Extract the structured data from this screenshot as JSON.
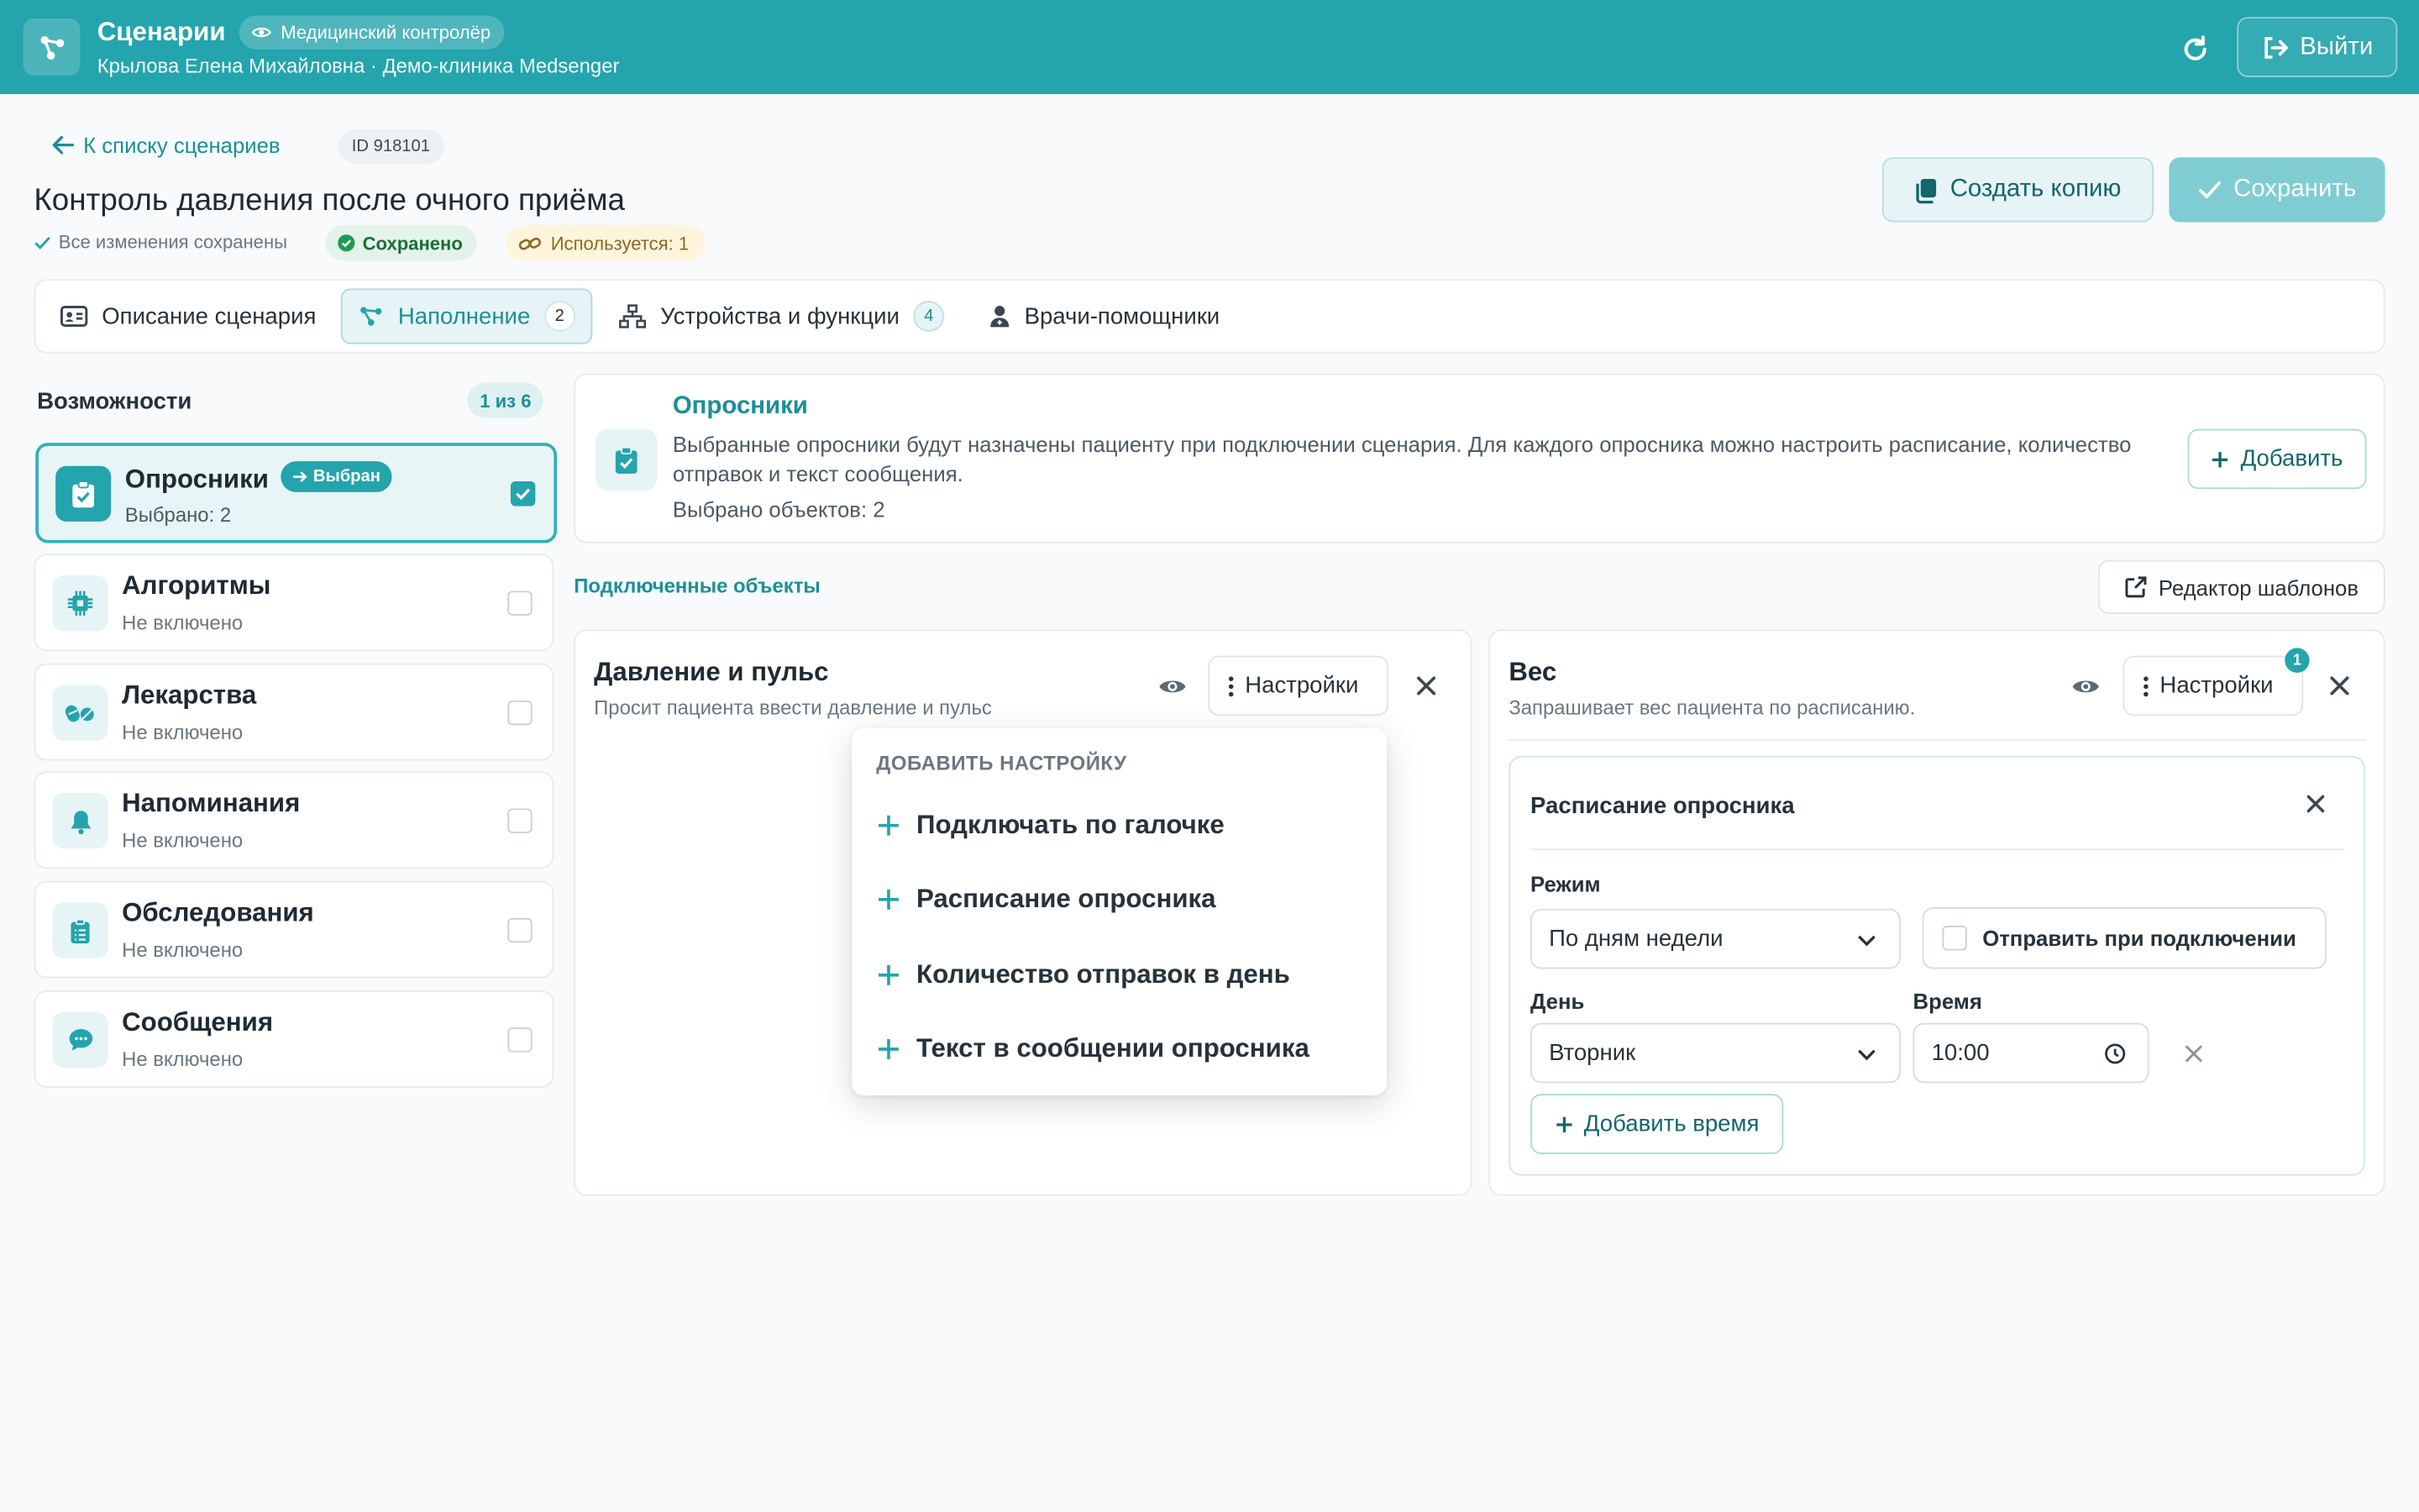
{
  "header": {
    "title": "Сценарии",
    "role": "Медицинский контролёр",
    "user": "Крылова Елена Михайловна · Демо-клиника Medsenger",
    "logout": "Выйти"
  },
  "top": {
    "back": "К списку сценариев",
    "id": "ID 918101",
    "title": "Контроль давления после очного приёма",
    "saved_note": "Все изменения сохранены",
    "badge_saved": "Сохранено",
    "badge_used": "Используется: 1",
    "btn_copy": "Создать копию",
    "btn_save": "Сохранить"
  },
  "tabs": [
    {
      "label": "Описание сценария",
      "count": ""
    },
    {
      "label": "Наполнение",
      "count": "2"
    },
    {
      "label": "Устройства и функции",
      "count": "4"
    },
    {
      "label": "Врачи-помощники",
      "count": ""
    }
  ],
  "capabilities": {
    "title": "Возможности",
    "count": "1 из 6",
    "selected_badge": "Выбран",
    "items": [
      {
        "title": "Опросники",
        "sub": "Выбрано: 2",
        "icon": "clipboard-check-icon"
      },
      {
        "title": "Алгоритмы",
        "sub": "Не включено",
        "icon": "chip-icon"
      },
      {
        "title": "Лекарства",
        "sub": "Не включено",
        "icon": "pills-icon"
      },
      {
        "title": "Напоминания",
        "sub": "Не включено",
        "icon": "bell-icon"
      },
      {
        "title": "Обследования",
        "sub": "Не включено",
        "icon": "clipboard-list-icon"
      },
      {
        "title": "Сообщения",
        "sub": "Не включено",
        "icon": "chat-icon"
      }
    ]
  },
  "info": {
    "title": "Опросники",
    "desc": "Выбранные опросники будут назначены пациенту при подключении сценария. Для каждого опросника можно настроить расписание, количество отправок и текст сообщения.",
    "count": "Выбрано объектов: 2",
    "btn_add": "Добавить"
  },
  "connected": {
    "title": "Подключенные объекты",
    "btn_templates": "Редактор шаблонов"
  },
  "objects": [
    {
      "title": "Давление и пульс",
      "sub": "Просит пациента ввести давление и пульс",
      "settings": "Настройки"
    },
    {
      "title": "Вес",
      "sub": "Запрашивает вес пациента по расписанию.",
      "settings": "Настройки",
      "settings_count": "1"
    }
  ],
  "dropdown": {
    "header": "ДОБАВИТЬ НАСТРОЙКУ",
    "items": [
      "Подключать по галочке",
      "Расписание опросника",
      "Количество отправок в день",
      "Текст в сообщении опросника"
    ]
  },
  "schedule": {
    "title": "Расписание опросника",
    "mode_label": "Режим",
    "mode_value": "По дням недели",
    "send_on_connect": "Отправить при подключении",
    "day_label": "День",
    "day_value": "Вторник",
    "time_label": "Время",
    "time_value": "10:00",
    "btn_add_time": "Добавить время"
  },
  "colors": {
    "accent": "#24a4ad",
    "accent_dark": "#1b8f98"
  }
}
